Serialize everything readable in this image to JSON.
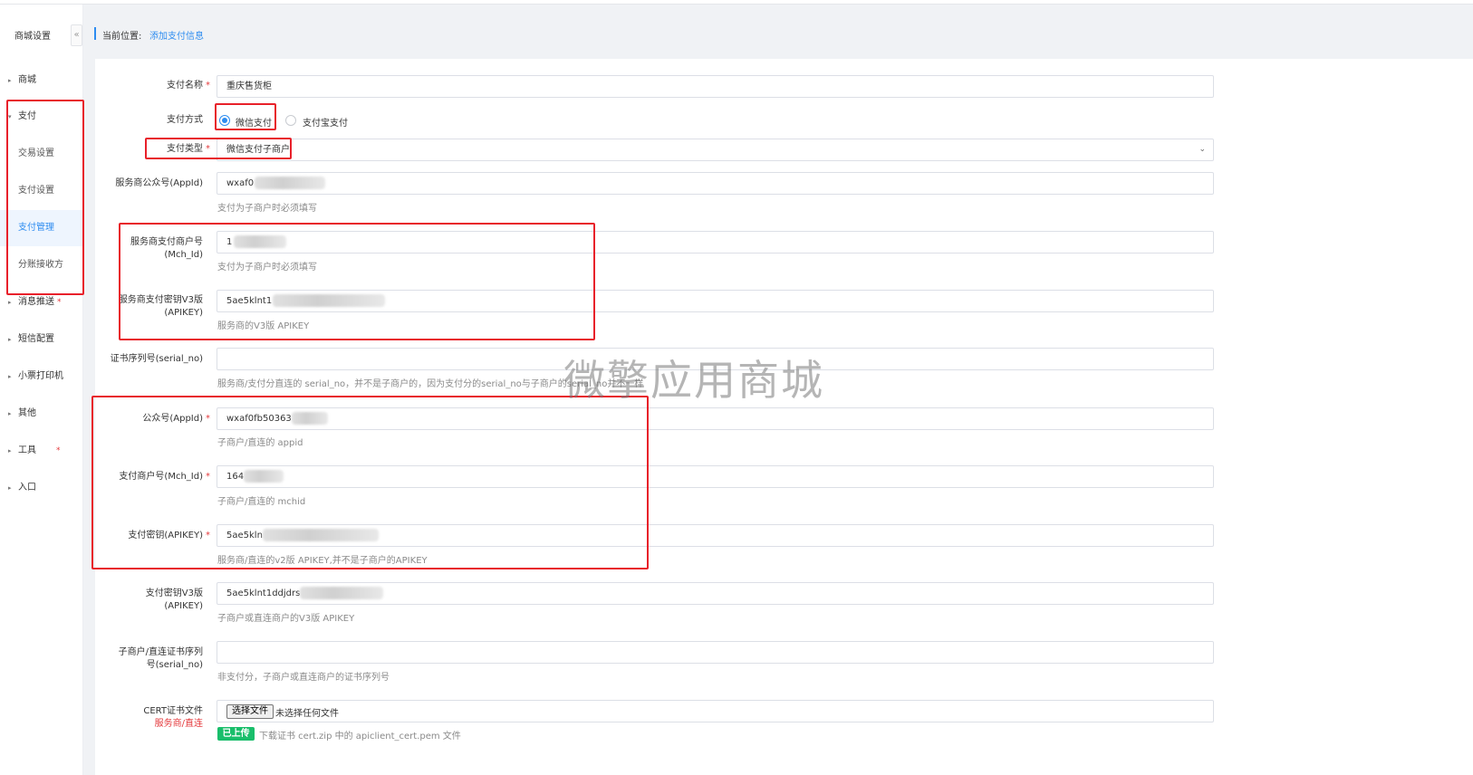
{
  "sidebar": {
    "title": "商城设置",
    "collapse_glyph": "«",
    "items": [
      {
        "label": "商城",
        "required": ""
      },
      {
        "label": "支付",
        "required": ""
      },
      {
        "label": "消息推送",
        "required": "*"
      },
      {
        "label": "短信配置",
        "required": ""
      },
      {
        "label": "小票打印机",
        "required": ""
      },
      {
        "label": "其他",
        "required": ""
      },
      {
        "label": "工具",
        "required": "*"
      },
      {
        "label": "入口",
        "required": ""
      }
    ],
    "subitems": [
      {
        "label": "交易设置",
        "active": false
      },
      {
        "label": "支付设置",
        "active": false
      },
      {
        "label": "支付管理",
        "active": true
      },
      {
        "label": "分账接收方",
        "active": false
      }
    ]
  },
  "breadcrumb": {
    "label": "当前位置:",
    "current": "添加支付信息"
  },
  "form": {
    "pay_name": {
      "label": "支付名称",
      "value": "重庆售货柜"
    },
    "pay_method": {
      "label": "支付方式",
      "options": [
        "微信支付",
        "支付宝支付"
      ],
      "selected": "微信支付"
    },
    "pay_type": {
      "label": "支付类型",
      "value": "微信支付子商户"
    },
    "sp_appid": {
      "label": "服务商公众号(AppId)",
      "value": "wxaf0",
      "hint": "支付为子商户时必须填写"
    },
    "sp_mchid": {
      "label_line1": "服务商支付商户号",
      "label_line2": "(Mch_Id)",
      "value": "1",
      "hint": "支付为子商户时必须填写"
    },
    "sp_apikey_v3": {
      "label_line1": "服务商支付密钥V3版",
      "label_line2": "(APIKEY)",
      "value": "5ae5klnt1",
      "hint": "服务商的V3版 APIKEY"
    },
    "serial_no": {
      "label": "证书序列号(serial_no)",
      "value": "",
      "hint": "服务商/支付分直连的 serial_no，并不是子商户的，因为支付分的serial_no与子商户的serial_no并不一样"
    },
    "appid": {
      "label": "公众号(AppId)",
      "value": "wxaf0fb50363",
      "hint": "子商户/直连的 appid"
    },
    "mchid": {
      "label": "支付商户号(Mch_Id)",
      "value": "164",
      "hint": "子商户/直连的 mchid"
    },
    "apikey": {
      "label": "支付密钥(APIKEY)",
      "value": "5ae5kln",
      "hint": "服务商/直连的v2版 APIKEY,并不是子商户的APIKEY"
    },
    "apikey_v3": {
      "label_line1": "支付密钥V3版",
      "label_line2": "(APIKEY)",
      "value": "5ae5klnt1ddjdrs",
      "hint": "子商户或直连商户的V3版 APIKEY"
    },
    "sub_serial": {
      "label_line1": "子商户/直连证书序列",
      "label_line2": "号(serial_no)",
      "value": "",
      "hint": "非支付分，子商户或直连商户的证书序列号"
    },
    "cert": {
      "label": "CERT证书文件",
      "sublabel": "服务商/直连",
      "button": "选择文件",
      "no_file": "未选择任何文件",
      "badge": "已上传",
      "hint": "下载证书 cert.zip 中的 apiclient_cert.pem 文件"
    }
  },
  "watermark": "微擎应用商城",
  "colors": {
    "accent": "#2d8cf0",
    "required": "#e4393c",
    "highlight_box": "#e8202a",
    "success": "#19be6b"
  },
  "icons": {
    "caret": "▸",
    "select_arrow": "⌄"
  }
}
